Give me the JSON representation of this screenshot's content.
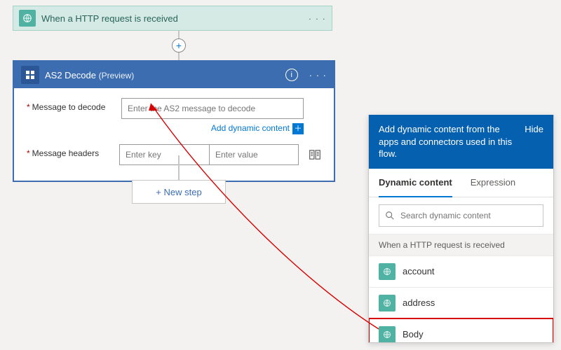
{
  "trigger": {
    "title": "When a HTTP request is received"
  },
  "decode": {
    "title": "AS2 Decode",
    "preview": "(Preview)",
    "fields": {
      "message_label": "Message to decode",
      "message_placeholder": "Enter the AS2 message to decode",
      "add_dynamic": "Add dynamic content",
      "headers_label": "Message headers",
      "key_placeholder": "Enter key",
      "value_placeholder": "Enter value"
    }
  },
  "new_step_label": "+ New step",
  "picker": {
    "blurb": "Add dynamic content from the apps and connectors used in this flow.",
    "hide": "Hide",
    "tab_dynamic": "Dynamic content",
    "tab_expression": "Expression",
    "search_placeholder": "Search dynamic content",
    "group_title": "When a HTTP request is received",
    "items": [
      "account",
      "address",
      "Body"
    ]
  }
}
